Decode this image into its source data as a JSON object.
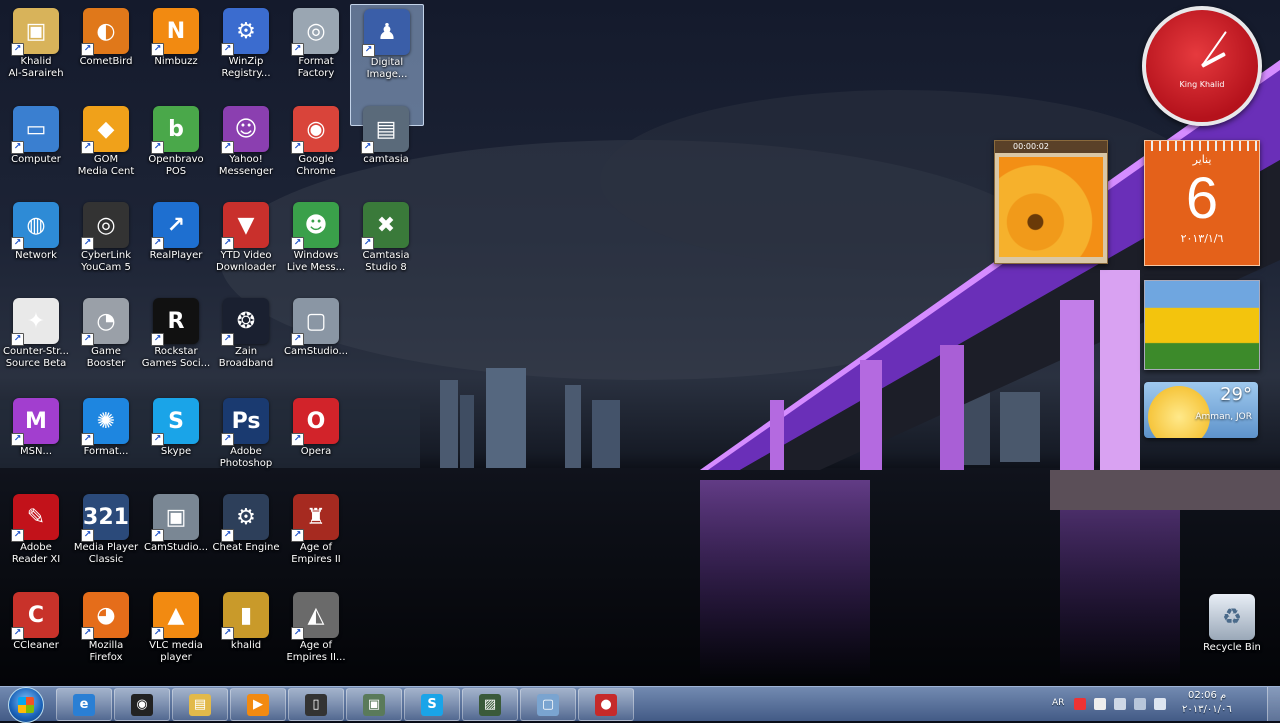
{
  "desktop": {
    "icons": [
      {
        "label": "Khalid\nAl-Saraireh",
        "glyph": "▣",
        "color": "#d8b35a",
        "icon": "folder-user-icon"
      },
      {
        "label": "CometBird",
        "glyph": "◐",
        "color": "#e0781a",
        "icon": "cometbird-icon"
      },
      {
        "label": "Nimbuzz",
        "glyph": "N",
        "color": "#f28a11",
        "icon": "nimbuzz-icon"
      },
      {
        "label": "WinZip\nRegistry...",
        "glyph": "⚙",
        "color": "#3b6ccf",
        "icon": "winzip-registry-icon"
      },
      {
        "label": "Format\nFactory",
        "glyph": "◎",
        "color": "#9aa6b2",
        "icon": "format-factory-icon"
      },
      {
        "label": "Digital\nImage...",
        "glyph": "♟",
        "color": "#3a5ea8",
        "icon": "digital-image-icon"
      },
      {
        "label": "Computer",
        "glyph": "▭",
        "color": "#3a7fd0",
        "icon": "computer-icon"
      },
      {
        "label": "GOM\nMedia Cent",
        "glyph": "◆",
        "color": "#f0a11a",
        "icon": "gom-media-icon"
      },
      {
        "label": "Openbravo\nPOS",
        "glyph": "b",
        "color": "#4aa84a",
        "icon": "openbravo-icon"
      },
      {
        "label": "Yahoo!\nMessenger",
        "glyph": "☺",
        "color": "#8b3fb0",
        "icon": "yahoo-messenger-icon"
      },
      {
        "label": "Google\nChrome",
        "glyph": "◉",
        "color": "#d9443a",
        "icon": "chrome-icon"
      },
      {
        "label": "camtasia",
        "glyph": "▤",
        "color": "#5a6a7a",
        "icon": "camtasia-folder-icon"
      },
      {
        "label": "Network",
        "glyph": "◍",
        "color": "#2e8bd6",
        "icon": "network-icon"
      },
      {
        "label": "CyberLink\nYouCam 5",
        "glyph": "◎",
        "color": "#333",
        "icon": "youcam-icon"
      },
      {
        "label": "RealPlayer",
        "glyph": "↗",
        "color": "#1e6fd0",
        "icon": "realplayer-icon"
      },
      {
        "label": "YTD Video\nDownloader",
        "glyph": "▼",
        "color": "#c9302c",
        "icon": "ytd-icon"
      },
      {
        "label": "Windows\nLive Mess...",
        "glyph": "☻",
        "color": "#3aa04a",
        "icon": "live-messenger-icon"
      },
      {
        "label": "Camtasia\nStudio 8",
        "glyph": "✖",
        "color": "#3a7a3a",
        "icon": "camtasia-studio-icon"
      },
      {
        "label": "Counter-Str...\nSource Beta",
        "glyph": "✦",
        "color": "#e9e9e9",
        "icon": "counter-strike-icon"
      },
      {
        "label": "Game\nBooster",
        "glyph": "◔",
        "color": "#9aa0a8",
        "icon": "game-booster-icon"
      },
      {
        "label": "Rockstar\nGames Soci...",
        "glyph": "R",
        "color": "#111",
        "icon": "rockstar-icon"
      },
      {
        "label": "Zain\nBroadband",
        "glyph": "❂",
        "color": "#1a2030",
        "icon": "zain-broadband-icon"
      },
      {
        "label": "CamStudio...",
        "glyph": "▢",
        "color": "#8a96a4",
        "icon": "camstudio-icon"
      },
      {
        "label": "MSN...",
        "glyph": "M",
        "color": "#a23ecf",
        "icon": "msn-icon"
      },
      {
        "label": "Format...",
        "glyph": "✺",
        "color": "#1e86e0",
        "icon": "format-icon"
      },
      {
        "label": "Skype",
        "glyph": "S",
        "color": "#1aa4e8",
        "icon": "skype-icon"
      },
      {
        "label": "Adobe\nPhotoshop",
        "glyph": "Ps",
        "color": "#1a3a70",
        "icon": "photoshop-icon"
      },
      {
        "label": "Opera",
        "glyph": "O",
        "color": "#d2232a",
        "icon": "opera-icon"
      },
      {
        "label": "Adobe\nReader XI",
        "glyph": "✎",
        "color": "#c2121a",
        "icon": "adobe-reader-icon"
      },
      {
        "label": "Media Player\nClassic",
        "glyph": "321",
        "color": "#2b4a7a",
        "icon": "media-player-classic-icon"
      },
      {
        "label": "CamStudio...",
        "glyph": "▣",
        "color": "#7a8794",
        "icon": "camstudio2-icon"
      },
      {
        "label": "Cheat Engine",
        "glyph": "⚙",
        "color": "#2d3f5a",
        "icon": "cheat-engine-icon"
      },
      {
        "label": "Age of\nEmpires II",
        "glyph": "♜",
        "color": "#a62a20",
        "icon": "age-of-empires-icon"
      },
      {
        "label": "CCleaner",
        "glyph": "C",
        "color": "#c8322a",
        "icon": "ccleaner-icon"
      },
      {
        "label": "Mozilla\nFirefox",
        "glyph": "◕",
        "color": "#e56d1a",
        "icon": "firefox-icon"
      },
      {
        "label": "VLC media\nplayer",
        "glyph": "▲",
        "color": "#f28a11",
        "icon": "vlc-icon"
      },
      {
        "label": "khalid",
        "glyph": "▮",
        "color": "#c99a2a",
        "icon": "khalid-file-icon"
      },
      {
        "label": "Age of\nEmpires II...",
        "glyph": "◭",
        "color": "#6a6a6a",
        "icon": "age-of-empires2-icon"
      }
    ],
    "recycle_bin": {
      "label": "Recycle Bin"
    }
  },
  "gadgets": {
    "clock": {
      "name": "King Khalid"
    },
    "slideshow": {
      "counter": "00:00:02"
    },
    "calendar": {
      "month": "يناير",
      "day": "6",
      "date": "٢٠١٣/١/٦"
    },
    "weather": {
      "temp": "29°",
      "city": "Amman, JOR"
    }
  },
  "taskbar": {
    "apps": [
      {
        "icon": "internet-explorer-icon",
        "glyph": "e",
        "color": "#2a7fd4"
      },
      {
        "icon": "media-app-icon",
        "glyph": "◉",
        "color": "#222"
      },
      {
        "icon": "explorer-folder-icon",
        "glyph": "▤",
        "color": "#e2b94a"
      },
      {
        "icon": "media-player-icon",
        "glyph": "▶",
        "color": "#f28a11"
      },
      {
        "icon": "phone-app-icon",
        "glyph": "▯",
        "color": "#333"
      },
      {
        "icon": "window-app-icon",
        "glyph": "▣",
        "color": "#5a7a5a"
      },
      {
        "icon": "skype-taskbar-icon",
        "glyph": "S",
        "color": "#1aa4e8"
      },
      {
        "icon": "camtasia-taskbar-icon",
        "glyph": "▨",
        "color": "#3a5a3a"
      },
      {
        "icon": "document-app-icon",
        "glyph": "▢",
        "color": "#7aa4d0"
      },
      {
        "icon": "recorder-app-icon",
        "glyph": "●",
        "color": "#c62a2a"
      }
    ],
    "tray": {
      "lang": "AR",
      "time": "02:06 م",
      "date": "٢٠١٣/٠١/٠٦"
    }
  }
}
